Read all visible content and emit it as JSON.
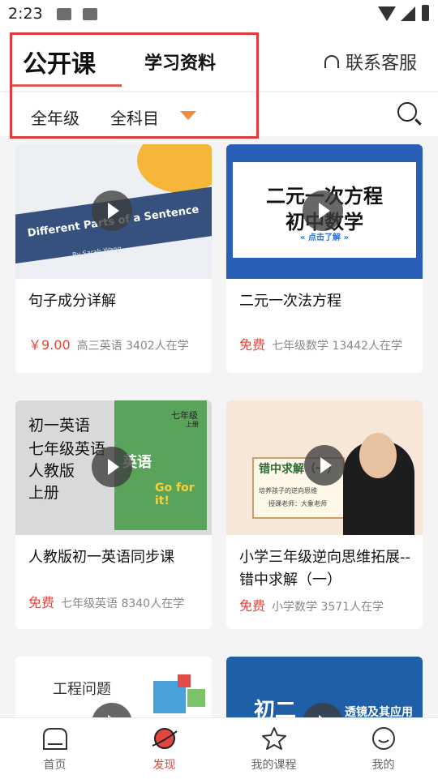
{
  "status_bar": {
    "time": "2:23"
  },
  "header": {
    "tabs": [
      {
        "label": "公开课",
        "active": true
      },
      {
        "label": "学习资料",
        "active": false
      }
    ],
    "service_label": "联系客服"
  },
  "filter": {
    "grade_label": "全年级",
    "subject_label": "全科目"
  },
  "courses": [
    {
      "title": "句子成分详解",
      "price": "￥9.00",
      "info": "高三英语 3402人在学",
      "thumb_text": [
        "Different Parts of a Sentence",
        "By Sarah Wang"
      ]
    },
    {
      "title": "二元一次法方程",
      "price": "免费",
      "info": "七年级数学 13442人在学",
      "thumb_text": [
        "二元一次方程",
        "初中数学",
        "« 点击了解 »"
      ]
    },
    {
      "title": "人教版初一英语同步课",
      "price": "免费",
      "info": "七年级英语 8340人在学",
      "thumb_text": [
        "初一英语",
        "七年级英语",
        "人教版",
        "上册",
        "英语",
        "七年级",
        "上册",
        "Go for it!"
      ]
    },
    {
      "title": "小学三年级逆向思维拓展--错中求解（一）",
      "price": "免费",
      "info": "小学数学 3571人在学",
      "thumb_text": [
        "错中求解（一）",
        "培养孩子的逆向思维",
        "授课老师：大象老师"
      ]
    },
    {
      "title": "",
      "price": "",
      "info": "",
      "thumb_text": [
        "工程问题"
      ]
    },
    {
      "title": "",
      "price": "",
      "info": "",
      "thumb_text": [
        "初二",
        "透镜及其应用"
      ]
    }
  ],
  "bottom_nav": [
    {
      "label": "首页",
      "icon": "home-icon",
      "active": false
    },
    {
      "label": "发现",
      "icon": "planet-icon",
      "active": true
    },
    {
      "label": "我的课程",
      "icon": "star-icon",
      "active": false
    },
    {
      "label": "我的",
      "icon": "smiley-face-icon",
      "active": false
    }
  ],
  "colors": {
    "accent": "#e2463d",
    "highlight_box": "#e23b3b",
    "caret": "#f08a3c"
  }
}
